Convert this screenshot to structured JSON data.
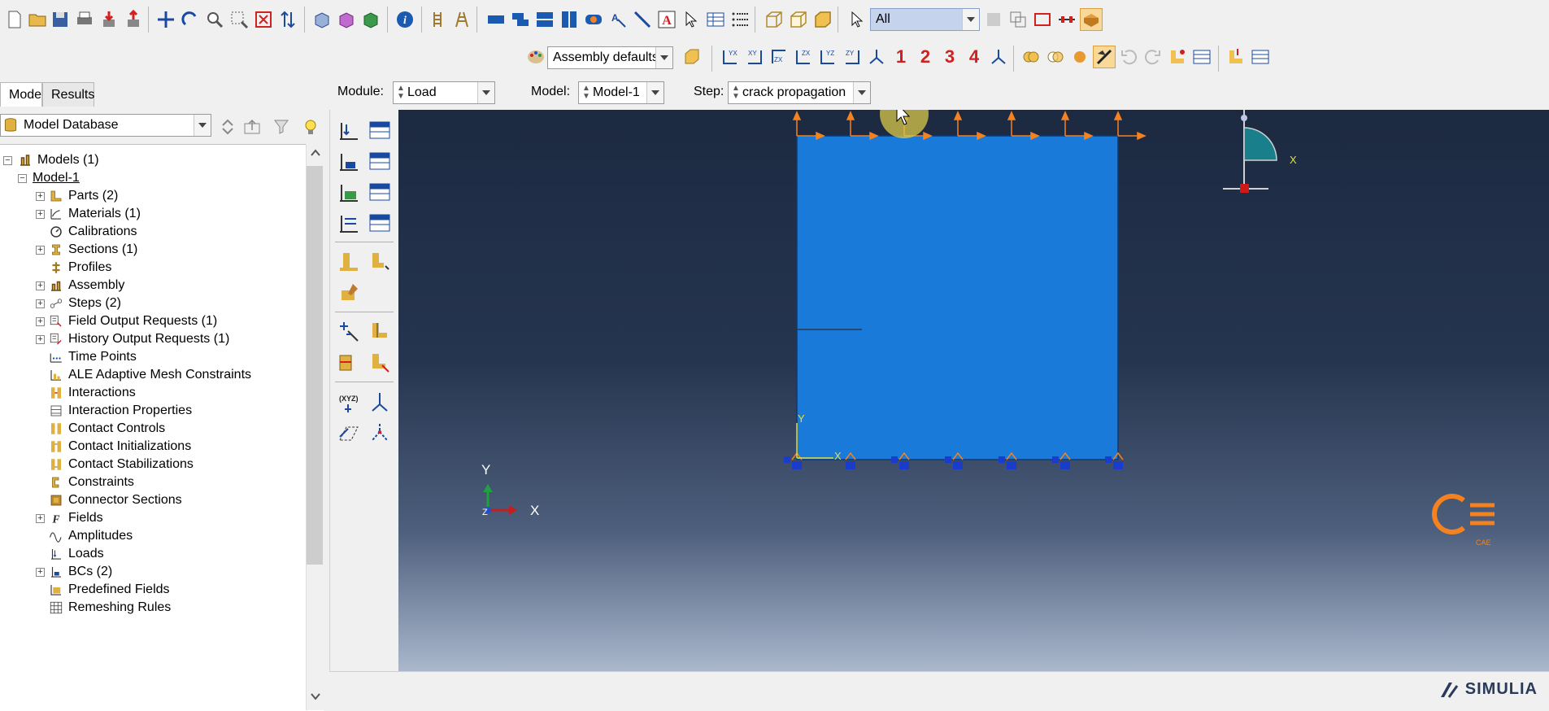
{
  "module_bar": {
    "module_label": "Module:",
    "module_value": "Load",
    "model_label": "Model:",
    "model_value": "Model-1",
    "step_label": "Step:",
    "step_value": "crack propagation"
  },
  "toolbar": {
    "selection_filter": "All",
    "render_style": "Assembly defaults",
    "view_numbers": [
      "1",
      "2",
      "3",
      "4"
    ]
  },
  "left_panel": {
    "tabs": [
      "Model",
      "Results"
    ],
    "active_tab": "Model",
    "database_combo": "Model Database",
    "tree": {
      "root": "Models (1)",
      "model": "Model-1",
      "items": [
        "Parts (2)",
        "Materials (1)",
        "Calibrations",
        "Sections (1)",
        "Profiles",
        "Assembly",
        "Steps (2)",
        "Field Output Requests (1)",
        "History Output Requests (1)",
        "Time Points",
        "ALE Adaptive Mesh Constraints",
        "Interactions",
        "Interaction Properties",
        "Contact Controls",
        "Contact Initializations",
        "Contact Stabilizations",
        "Constraints",
        "Connector Sections",
        "Fields",
        "Amplitudes",
        "Loads",
        "BCs (2)",
        "Predefined Fields",
        "Remeshing Rules"
      ]
    }
  },
  "viewport": {
    "triad_x": "X",
    "triad_y": "Y",
    "triad_z": "Z",
    "csys_x": "X",
    "csys_y": "Y",
    "inset_x": "X",
    "inset_y": "Y"
  },
  "branding": {
    "simulia": "SIMULIA",
    "watermark": "CAE"
  },
  "colors": {
    "part_fill": "#1a7ad9",
    "load_arrow": "#f58220",
    "bc_marker": "#1a3ccc",
    "viewport_top": "#1c2941",
    "viewport_bottom": "#aab7cd"
  }
}
